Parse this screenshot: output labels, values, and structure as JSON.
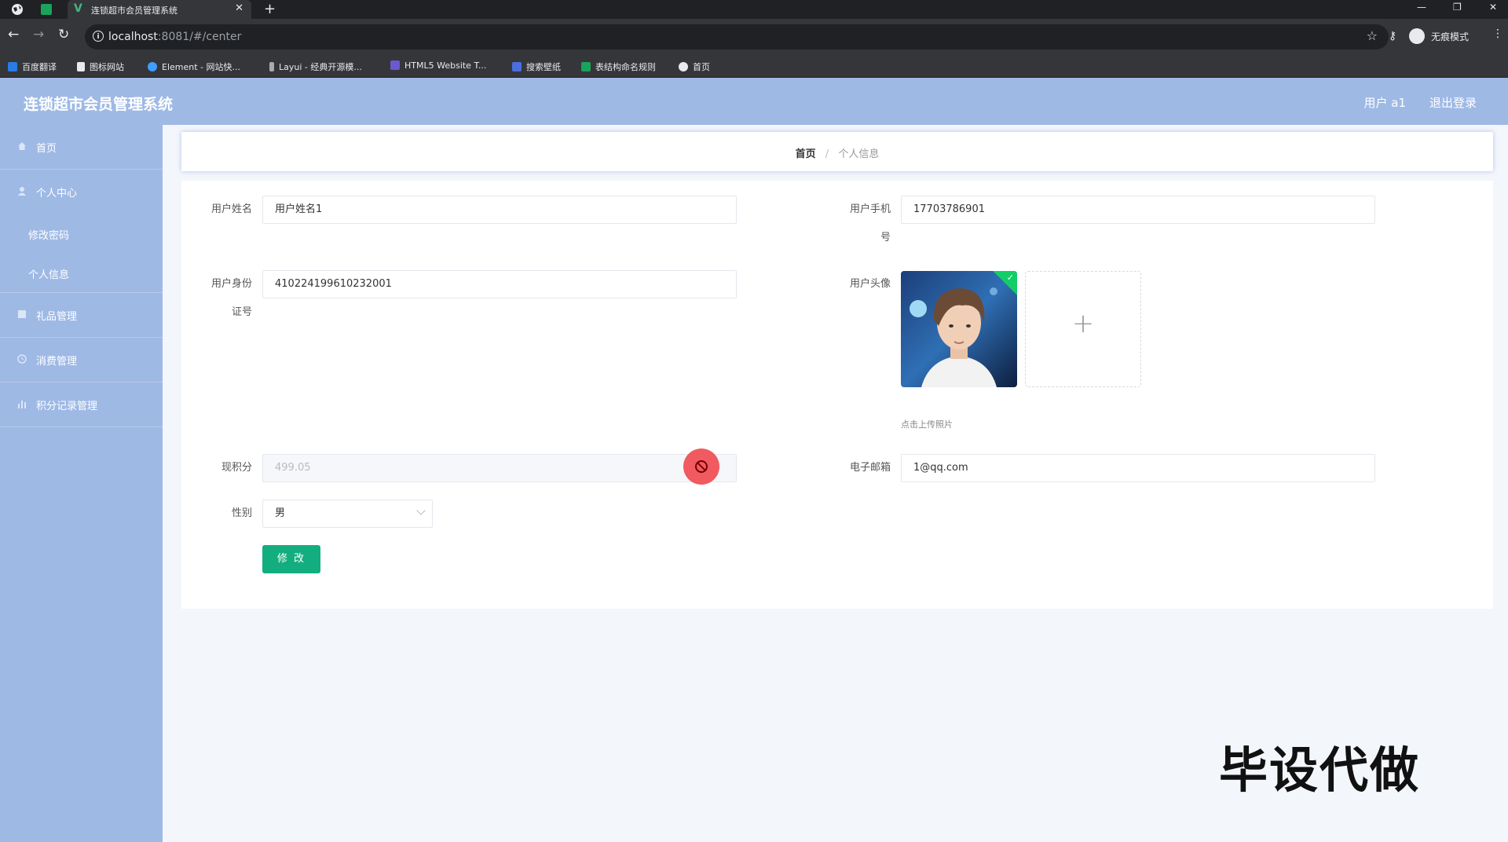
{
  "browser": {
    "tab_title": "连锁超市会员管理系统",
    "url_host": "localhost",
    "url_rest": ":8081/#/center",
    "profile_label": "无痕模式",
    "bookmarks": [
      "百度翻译",
      "图标网站",
      "Element - 网站快...",
      "Layui - 经典开源模...",
      "HTML5 Website T...",
      "搜索壁纸",
      "表结构命名规则",
      "首页"
    ]
  },
  "header": {
    "brand": "连锁超市会员管理系统",
    "user": "用户 a1",
    "logout": "退出登录"
  },
  "sidebar": {
    "items": [
      {
        "label": "首页",
        "icon": "home-icon"
      },
      {
        "label": "个人中心",
        "icon": "user-icon",
        "children": [
          "修改密码",
          "个人信息"
        ]
      },
      {
        "label": "礼品管理",
        "icon": "grid-icon"
      },
      {
        "label": "消费管理",
        "icon": "clock-icon"
      },
      {
        "label": "积分记录管理",
        "icon": "bar-chart-icon"
      }
    ]
  },
  "breadcrumb": {
    "home": "首页",
    "separator": "/",
    "current": "个人信息"
  },
  "form": {
    "name_label": "用户姓名",
    "name_value": "用户姓名1",
    "phone_label_1": "用户手机",
    "phone_label_2": "号",
    "phone_value": "17703786901",
    "idcard_label_1": "用户身份",
    "idcard_label_2": "证号",
    "idcard_value": "410224199610232001",
    "avatar_label": "用户头像",
    "upload_hint": "点击上传照片",
    "points_label": "现积分",
    "points_value": "499.05",
    "email_label": "电子邮箱",
    "email_value": "1@qq.com",
    "gender_label": "性别",
    "gender_value": "男",
    "submit_label": "修 改"
  },
  "colors": {
    "sidebar": "#9fb9e5",
    "button": "#13ae7f",
    "success_badge": "#13ce66"
  },
  "watermark": "毕设代做"
}
